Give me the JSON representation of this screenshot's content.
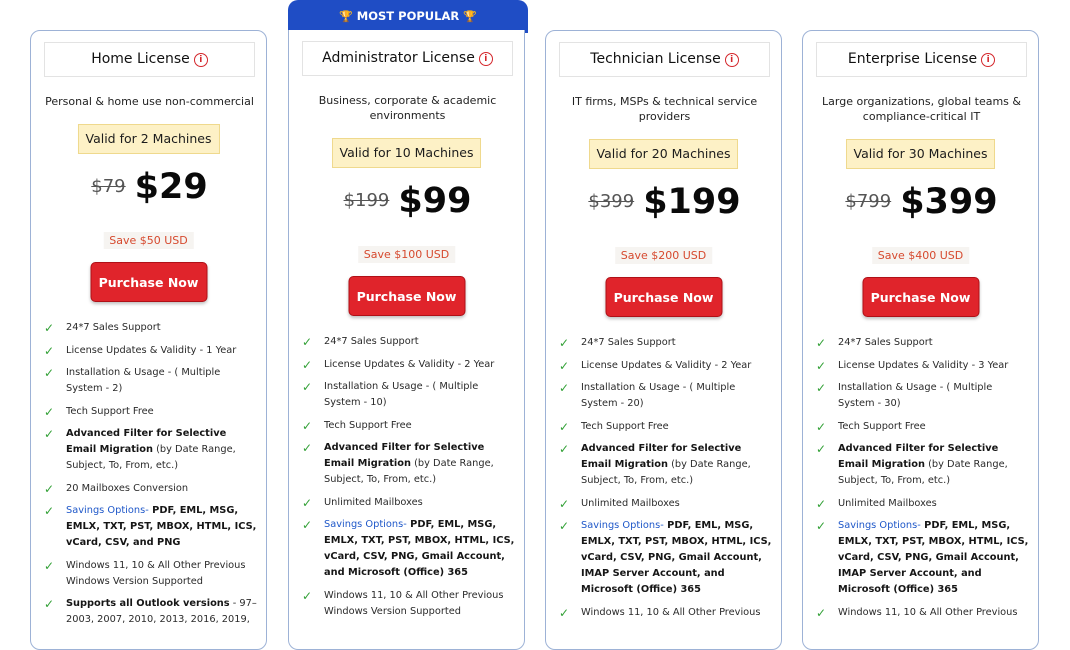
{
  "popular_label": "MOST POPULAR",
  "colors": {
    "accent_blue": "#1f4dc5",
    "buy_red": "#e0242b",
    "check_green": "#33a137",
    "save_red": "#d6492e"
  },
  "cards": [
    {
      "title": "Home License",
      "desc": "Personal & home use non-commercial",
      "valid": "Valid for 2 Machines",
      "old_price": "$79",
      "price": "$29",
      "save": "Save $50 USD",
      "button": "Purchase Now",
      "f1": "24*7 Sales Support",
      "f2": "License Updates & Validity - 1 Year",
      "f3": "Installation & Usage - ( Multiple System - 2)",
      "f4": "Tech Support Free",
      "f5_bold": "Advanced Filter for Selective Email Migration",
      "f5_rest": " (by Date Range, Subject, To, From, etc.)",
      "f6": "20 Mailboxes Conversion",
      "f7_label": "Savings Options-",
      "f7_rest": " PDF, EML, MSG, EMLX, TXT, PST, MBOX, HTML, ICS, vCard, CSV, and PNG",
      "f8": "Windows 11, 10 & All Other Previous Windows Version Supported",
      "f9_bold": "Supports all Outlook versions",
      "f9_rest": " - 97–2003, 2007, 2010, 2013, 2016, 2019,"
    },
    {
      "title": "Administrator License",
      "desc": "Business, corporate & academic environments",
      "valid": "Valid for 10 Machines",
      "old_price": "$199",
      "price": "$99",
      "save": "Save $100 USD",
      "button": "Purchase Now",
      "f1": "24*7 Sales Support",
      "f2": "License Updates & Validity - 2 Year",
      "f3": "Installation & Usage - ( Multiple System - 10)",
      "f4": "Tech Support Free",
      "f5_bold": "Advanced Filter for Selective Email Migration",
      "f5_rest": " (by Date Range, Subject, To, From, etc.)",
      "f6": "Unlimited Mailboxes",
      "f7_label": "Savings Options-",
      "f7_rest": " PDF, EML, MSG, EMLX, TXT, PST, MBOX, HTML, ICS, vCard, CSV, PNG, Gmail Account, and Microsoft (Office) 365",
      "f8": "Windows 11, 10 & All Other Previous Windows Version Supported"
    },
    {
      "title": "Technician License",
      "desc": "IT firms, MSPs & technical service providers",
      "valid": "Valid for 20 Machines",
      "old_price": "$399",
      "price": "$199",
      "save": "Save $200 USD",
      "button": "Purchase Now",
      "f1": "24*7 Sales Support",
      "f2": "License Updates & Validity - 2 Year",
      "f3": "Installation & Usage - ( Multiple System - 20)",
      "f4": "Tech Support Free",
      "f5_bold": "Advanced Filter for Selective Email Migration",
      "f5_rest": " (by Date Range, Subject, To, From, etc.)",
      "f6": "Unlimited Mailboxes",
      "f7_label": "Savings Options-",
      "f7_rest": " PDF, EML, MSG, EMLX, TXT, PST, MBOX, HTML, ICS, vCard, CSV, PNG, Gmail Account, IMAP Server Account, and Microsoft (Office) 365",
      "f8": "Windows 11, 10 & All Other Previous"
    },
    {
      "title": "Enterprise License",
      "desc": "Large organizations, global teams & compliance-critical IT",
      "valid": "Valid for 30 Machines",
      "old_price": "$799",
      "price": "$399",
      "save": "Save $400 USD",
      "button": "Purchase Now",
      "f1": "24*7 Sales Support",
      "f2": "License Updates & Validity - 3 Year",
      "f3": "Installation & Usage - ( Multiple System - 30)",
      "f4": "Tech Support Free",
      "f5_bold": "Advanced Filter for Selective Email Migration",
      "f5_rest": " (by Date Range, Subject, To, From, etc.)",
      "f6": "Unlimited Mailboxes",
      "f7_label": "Savings Options-",
      "f7_rest": " PDF, EML, MSG, EMLX, TXT, PST, MBOX, HTML, ICS, vCard, CSV, PNG, Gmail Account, IMAP Server Account, and Microsoft (Office) 365",
      "f8": "Windows 11, 10 & All Other Previous"
    }
  ]
}
